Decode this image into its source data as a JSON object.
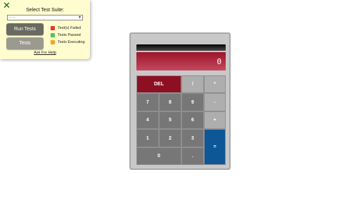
{
  "panel": {
    "close_glyph": "✕",
    "suite_label": "Select Test Suite:",
    "suite_selected": "- - -",
    "run_button": "Run Tests",
    "tests_button": "Tests",
    "legend": [
      {
        "label": "Test(s) Failed",
        "color": "#e53b2c"
      },
      {
        "label": "Tests Passed",
        "color": "#4fc94f"
      },
      {
        "label": "Tests Executing",
        "color": "#f0a81b"
      }
    ],
    "help_link": "Ask For Help"
  },
  "calculator": {
    "display": "0",
    "keys": {
      "del": "DEL",
      "divide": "/",
      "multiply": "*",
      "seven": "7",
      "eight": "8",
      "nine": "9",
      "subtract": "-",
      "four": "4",
      "five": "5",
      "six": "6",
      "add": "+",
      "one": "1",
      "two": "2",
      "three": "3",
      "equals": "=",
      "zero": "0",
      "decimal": "."
    }
  }
}
